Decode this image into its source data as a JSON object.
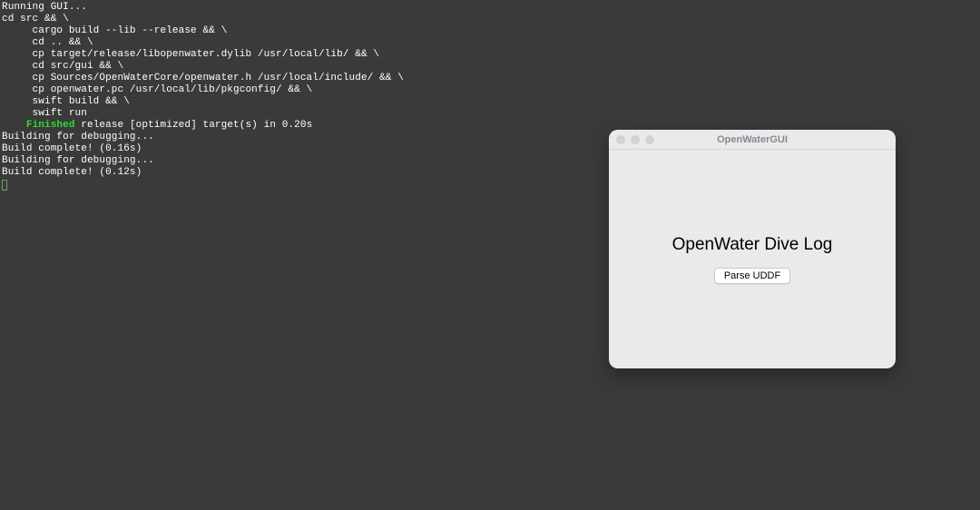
{
  "terminal": {
    "lines": [
      {
        "t": "Running GUI..."
      },
      {
        "t": "cd src && \\"
      },
      {
        "t": "     cargo build --lib --release && \\"
      },
      {
        "t": "     cd .. && \\"
      },
      {
        "t": "     cp target/release/libopenwater.dylib /usr/local/lib/ && \\"
      },
      {
        "t": "     cd src/gui && \\"
      },
      {
        "t": "     cp Sources/OpenWaterCore/openwater.h /usr/local/include/ && \\"
      },
      {
        "t": "     cp openwater.pc /usr/local/lib/pkgconfig/ && \\"
      },
      {
        "t": "     swift build && \\"
      },
      {
        "t": "     swift run"
      },
      {
        "prefix": "    ",
        "green": "Finished",
        "rest": " release [optimized] target(s) in 0.20s"
      },
      {
        "t": "Building for debugging..."
      },
      {
        "t": "Build complete! (0.16s)"
      },
      {
        "t": "Building for debugging..."
      },
      {
        "t": "Build complete! (0.12s)"
      }
    ]
  },
  "app": {
    "title": "OpenWaterGUI",
    "heading": "OpenWater Dive Log",
    "button_label": "Parse UDDF"
  }
}
